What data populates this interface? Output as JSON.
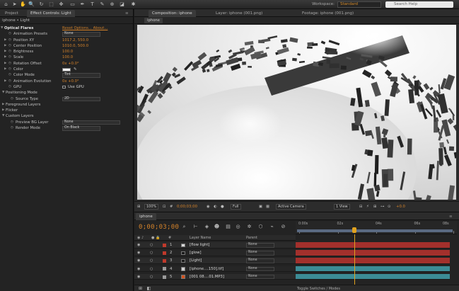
{
  "workspace": {
    "label": "Workspace:",
    "value": "Standard"
  },
  "search": {
    "placeholder": "Search Help"
  },
  "left_panel": {
    "tabs": [
      "Project",
      "Effect Controls: Light"
    ],
    "subheader": "iphone • Light",
    "properties": [
      {
        "label": "Optical Flares",
        "kind": "header",
        "links": "Reset   Options...   About..."
      },
      {
        "label": "Animation Presets",
        "kind": "dropdown",
        "value": "None"
      },
      {
        "label": "Position XY",
        "kind": "value",
        "value": "1017.2, 550.0"
      },
      {
        "label": "Center Position",
        "kind": "value",
        "value": "1010.0, 500.0"
      },
      {
        "label": "Brightness",
        "kind": "value",
        "value": "100.0"
      },
      {
        "label": "Scale",
        "kind": "value",
        "value": "100.0"
      },
      {
        "label": "Rotation Offset",
        "kind": "value",
        "value": "0x +0.0°"
      },
      {
        "label": "Color",
        "kind": "color"
      },
      {
        "label": "Color Mode",
        "kind": "dropdown",
        "value": "Tint"
      },
      {
        "label": "Animation Evolution",
        "kind": "value",
        "value": "0x +0.0°"
      },
      {
        "label": "GPU",
        "kind": "checkbox",
        "value": "Use GPU"
      },
      {
        "label": "Positioning Mode",
        "kind": "group"
      },
      {
        "label": "Source Type",
        "kind": "dropdown",
        "value": "2D"
      },
      {
        "label": "Foreground Layers",
        "kind": "group"
      },
      {
        "label": "Flicker",
        "kind": "group"
      },
      {
        "label": "Custom Layers",
        "kind": "group"
      },
      {
        "label": "Preview BG Layer",
        "kind": "dropdown-wide",
        "value": "None"
      },
      {
        "label": "Render Mode",
        "kind": "dropdown",
        "value": "On Black"
      }
    ]
  },
  "composition": {
    "tabs": [
      "Composition: iphone",
      "Layer: iphone (001.png)",
      "Footage: iphone (001.png)"
    ],
    "active_comp": "iphone",
    "viewer_bar": {
      "zoom": "100%",
      "timecode": "0;00;03;00",
      "resolution": "Full",
      "camera": "Active Camera",
      "views": "1 View",
      "exposure": "+0.0"
    }
  },
  "timeline": {
    "tab": "iphone",
    "timecode": "0;00;03;00",
    "ruler_labels": [
      "0:00s",
      "02s",
      "04s",
      "06s",
      "08s"
    ],
    "columns": {
      "name": "Layer Name",
      "parent": "Parent"
    },
    "layers": [
      {
        "num": "1",
        "name": "[flow light]",
        "parent": "None",
        "label_color": "#c0392b",
        "src_color": "#d9d9d9",
        "bar_color": "#a3302c"
      },
      {
        "num": "2",
        "name": "[glow]",
        "parent": "None",
        "label_color": "#c0392b",
        "src_color": "#1a1a1a",
        "bar_color": "#a3302c"
      },
      {
        "num": "3",
        "name": "[Light]",
        "parent": "None",
        "label_color": "#c0392b",
        "src_color": "#1a1a1a",
        "bar_color": "#a3302c"
      },
      {
        "num": "4",
        "name": "[iphone....150].tif]",
        "parent": "None",
        "label_color": "#9a9a9a",
        "src_color": "#cfcfcf",
        "bar_color": "#3c8c96"
      },
      {
        "num": "5",
        "name": "[001 08....01.MP3]",
        "parent": "None",
        "label_color": "#9a9a9a",
        "src_color": "#d4531f",
        "bar_color": "#3c8c96"
      }
    ],
    "footer": "Toggle Switches / Modes"
  },
  "colors": {
    "accent": "#d4822a",
    "cti": "#e0a21f",
    "panel": "#232323"
  }
}
